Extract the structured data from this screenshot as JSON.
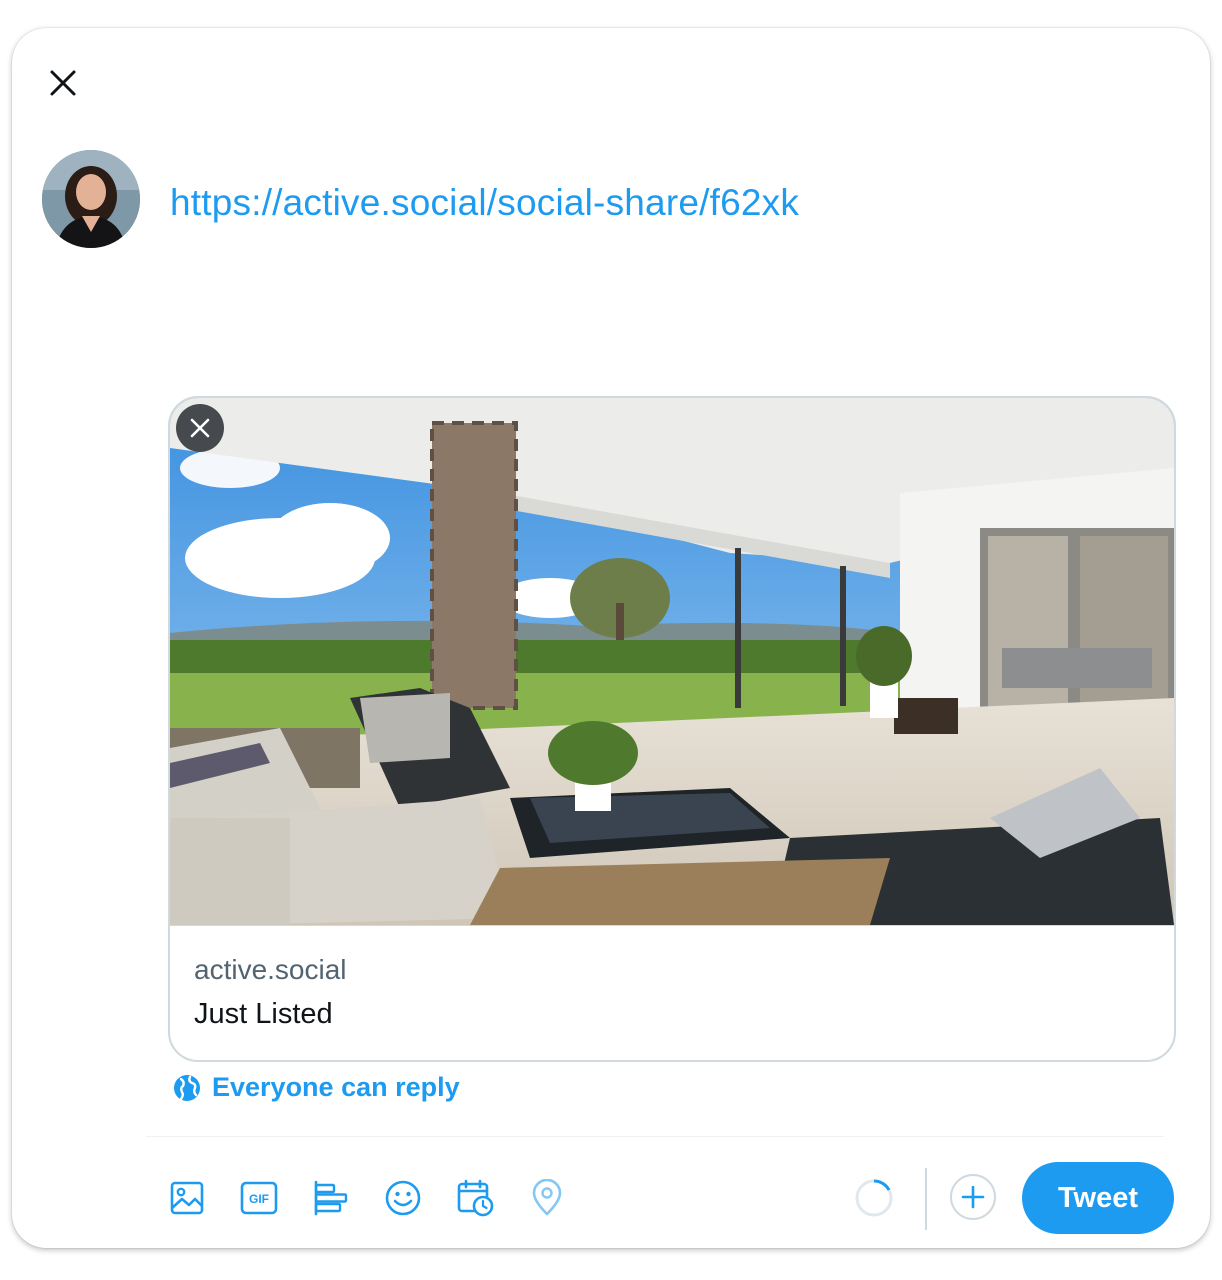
{
  "composer": {
    "text": "https://active.social/social-share/f62xk"
  },
  "link_card": {
    "domain": "active.social",
    "title": "Just Listed"
  },
  "reply_setting": {
    "label": "Everyone can reply"
  },
  "toolbar": {
    "icons": [
      "image-icon",
      "gif-icon",
      "poll-icon",
      "emoji-icon",
      "schedule-icon",
      "location-icon"
    ],
    "tweet_label": "Tweet"
  },
  "colors": {
    "accent": "#1d9bf0",
    "text": "#0f1419",
    "secondary_text": "#536471",
    "border": "#cfd9de"
  }
}
